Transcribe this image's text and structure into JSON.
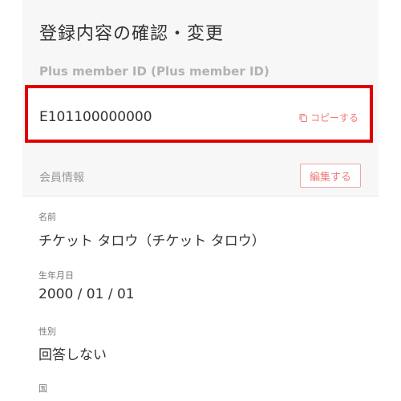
{
  "page": {
    "title": "登録内容の確認・変更"
  },
  "member": {
    "id_label": "Plus member ID (Plus member ID)",
    "id_value": "E101100000000",
    "copy_label": "コピーする"
  },
  "section": {
    "title": "会員情報",
    "edit_label": "編集する"
  },
  "fields": [
    {
      "label": "名前",
      "value": "チケット タロウ（チケット タロウ）"
    },
    {
      "label": "生年月日",
      "value": "2000 / 01 / 01"
    },
    {
      "label": "性別",
      "value": "回答しない"
    },
    {
      "label": "国",
      "value": ""
    }
  ],
  "colors": {
    "accent": "#f07a7a",
    "highlight_border": "#e00000"
  }
}
